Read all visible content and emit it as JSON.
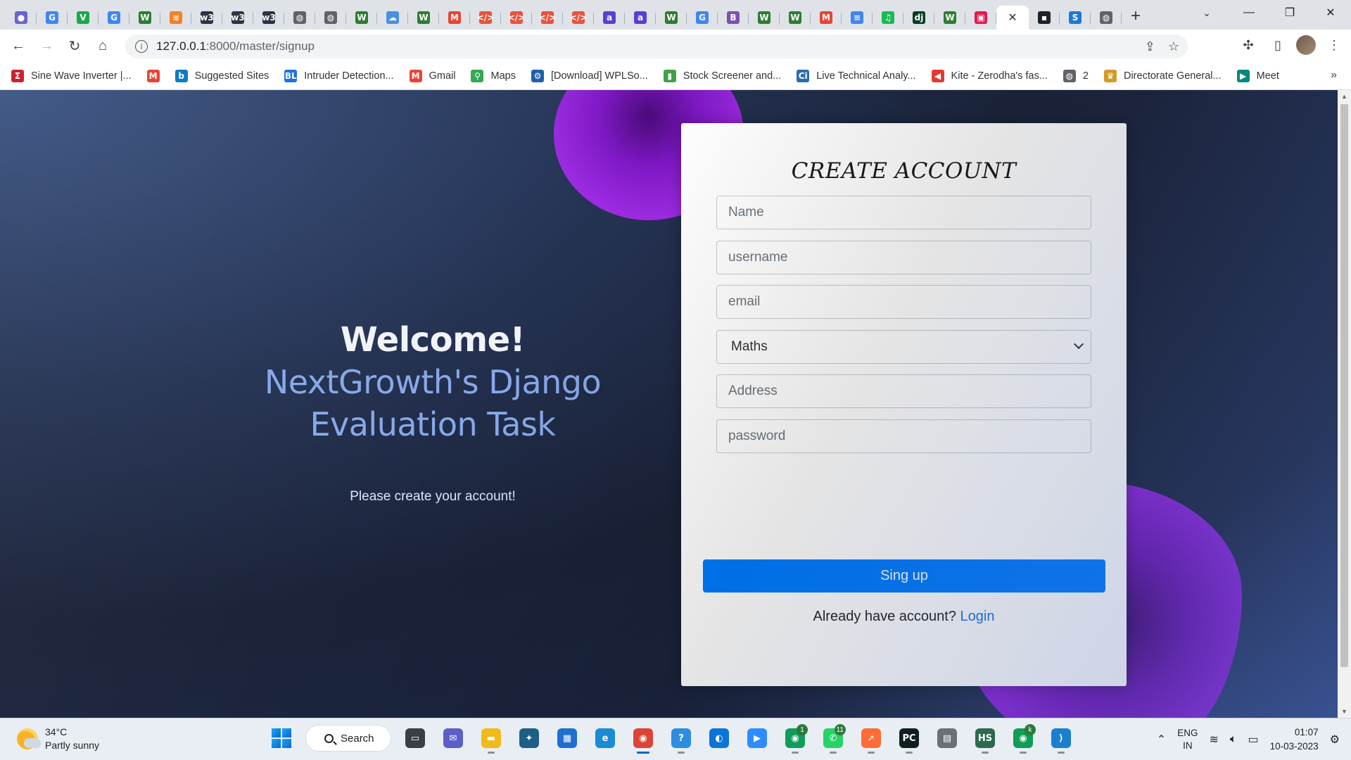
{
  "browser": {
    "tabs": [
      {
        "icon": "copilot-icon",
        "glyph": "●",
        "color": "#6b63d6"
      },
      {
        "icon": "google-icon",
        "glyph": "G",
        "color": "#4285f4"
      },
      {
        "icon": "vuetify-icon",
        "glyph": "V",
        "color": "#1ba84b"
      },
      {
        "icon": "google-icon",
        "glyph": "G",
        "color": "#4285f4"
      },
      {
        "icon": "w-icon",
        "glyph": "W",
        "color": "#2e7d32"
      },
      {
        "icon": "stack-icon",
        "glyph": "≋",
        "color": "#f58025"
      },
      {
        "icon": "w3-icon",
        "glyph": "w3",
        "color": "#2b3443"
      },
      {
        "icon": "w3-icon",
        "glyph": "w3",
        "color": "#2b3443"
      },
      {
        "icon": "w3-icon",
        "glyph": "w3",
        "color": "#2b3443"
      },
      {
        "icon": "globe-icon",
        "glyph": "◍",
        "color": "#5f6368"
      },
      {
        "icon": "globe-icon",
        "glyph": "◍",
        "color": "#5f6368"
      },
      {
        "icon": "w-icon",
        "glyph": "W",
        "color": "#2e7d32"
      },
      {
        "icon": "cloud-icon",
        "glyph": "☁",
        "color": "#4a90e2"
      },
      {
        "icon": "w-icon",
        "glyph": "W",
        "color": "#2e7d32"
      },
      {
        "icon": "gmail-icon",
        "glyph": "M",
        "color": "#ea4335"
      },
      {
        "icon": "code-icon",
        "glyph": "</>",
        "color": "#e8533c"
      },
      {
        "icon": "code-icon",
        "glyph": "</>",
        "color": "#e8533c"
      },
      {
        "icon": "code-icon",
        "glyph": "</>",
        "color": "#e8533c"
      },
      {
        "icon": "code-icon",
        "glyph": "</>",
        "color": "#e8533c"
      },
      {
        "icon": "a-icon",
        "glyph": "a",
        "color": "#5b3fd6"
      },
      {
        "icon": "a-icon",
        "glyph": "a",
        "color": "#5b3fd6"
      },
      {
        "icon": "w-icon",
        "glyph": "W",
        "color": "#2e7d32"
      },
      {
        "icon": "google-icon",
        "glyph": "G",
        "color": "#4285f4"
      },
      {
        "icon": "bootstrap-icon",
        "glyph": "B",
        "color": "#7952b3"
      },
      {
        "icon": "w-icon",
        "glyph": "W",
        "color": "#2e7d32"
      },
      {
        "icon": "w-icon",
        "glyph": "W",
        "color": "#2e7d32"
      },
      {
        "icon": "gmail-icon",
        "glyph": "M",
        "color": "#ea4335"
      },
      {
        "icon": "docs-icon",
        "glyph": "≡",
        "color": "#4285f4"
      },
      {
        "icon": "spotify-icon",
        "glyph": "♫",
        "color": "#1db954"
      },
      {
        "icon": "django-icon",
        "glyph": "dj",
        "color": "#0c3c26"
      },
      {
        "icon": "w-icon",
        "glyph": "W",
        "color": "#2e7d32"
      },
      {
        "icon": "box-icon",
        "glyph": "▣",
        "color": "#e4194f"
      }
    ],
    "trailing_tabs": [
      {
        "icon": "terminal-icon",
        "glyph": "▪",
        "color": "#1f2328"
      },
      {
        "icon": "s-icon",
        "glyph": "S",
        "color": "#1f78d1"
      },
      {
        "icon": "globe-icon",
        "glyph": "◍",
        "color": "#5f6368"
      }
    ],
    "url_host": "127.0.0.1",
    "url_rest": ":8000/master/signup",
    "bookmarks": [
      {
        "label": "Sine Wave Inverter |...",
        "glyph": "Σ",
        "color": "#c9222f"
      },
      {
        "label": "",
        "glyph": "M",
        "color": "#ea4335"
      },
      {
        "label": "Suggested Sites",
        "glyph": "b",
        "color": "#0f7ac6"
      },
      {
        "label": "Intruder Detection...",
        "glyph": "BL",
        "color": "#1a73e8"
      },
      {
        "label": "Gmail",
        "glyph": "M",
        "color": "#ea4335"
      },
      {
        "label": "Maps",
        "glyph": "⚲",
        "color": "#34a853"
      },
      {
        "label": "[Download] WPLSo...",
        "glyph": "⚙",
        "color": "#1f5fa8"
      },
      {
        "label": "Stock Screener and...",
        "glyph": "▮",
        "color": "#43a047"
      },
      {
        "label": "Live Technical Analy...",
        "glyph": "Ci",
        "color": "#2a6db0"
      },
      {
        "label": "Kite - Zerodha's fas...",
        "glyph": "◀",
        "color": "#e53935"
      },
      {
        "label": "2",
        "glyph": "◍",
        "color": "#5f6368"
      },
      {
        "label": "Directorate General...",
        "glyph": "♛",
        "color": "#d39b24"
      },
      {
        "label": "Meet",
        "glyph": "▶",
        "color": "#00897b"
      }
    ],
    "bookmarks_more": "»"
  },
  "page": {
    "welcome": "Welcome!",
    "project_title_line1": "NextGrowth's Django",
    "project_title_line2": "Evaluation Task",
    "subtitle": "Please create your account!",
    "form": {
      "heading": "CREATE ACCOUNT",
      "name_placeholder": "Name",
      "username_placeholder": "username",
      "email_placeholder": "email",
      "subject_selected": "Maths",
      "address_placeholder": "Address",
      "password_placeholder": "password",
      "submit_label": "Sing up",
      "login_prompt": "Already have account?",
      "login_link": "Login"
    }
  },
  "taskbar": {
    "temperature": "34°C",
    "weather": "Partly sunny",
    "search_label": "Search",
    "apps": [
      {
        "icon": "file-explorer-icon",
        "glyph": "▬",
        "color": "#f2b91d",
        "running": true
      },
      {
        "icon": "mysql-workbench-icon",
        "glyph": "✦",
        "color": "#1e5e86",
        "running": false
      },
      {
        "icon": "microsoft-store-icon",
        "glyph": "▦",
        "color": "#1f6fd0",
        "running": false
      },
      {
        "icon": "edge-icon",
        "glyph": "e",
        "color": "#1b8bd3",
        "running": false
      },
      {
        "icon": "chrome-icon",
        "glyph": "◉",
        "color": "#db4437",
        "running": true,
        "active": true
      },
      {
        "icon": "help-icon",
        "glyph": "?",
        "color": "#2d8de0",
        "running": true
      },
      {
        "icon": "screen-icon",
        "glyph": "◐",
        "color": "#0b74d8",
        "running": false
      },
      {
        "icon": "zoom-icon",
        "glyph": "▶",
        "color": "#2d8cff",
        "running": false
      },
      {
        "icon": "chrome-profile-icon",
        "glyph": "◉",
        "color": "#0f9d58",
        "running": true,
        "badge": "1"
      },
      {
        "icon": "whatsapp-icon",
        "glyph": "✆",
        "color": "#25d366",
        "running": true,
        "badge": "11"
      },
      {
        "icon": "postman-icon",
        "glyph": "➚",
        "color": "#ff6c37",
        "running": true
      },
      {
        "icon": "pycharm-icon",
        "glyph": "PC",
        "color": "#0f1f1f",
        "running": true
      },
      {
        "icon": "calculator-icon",
        "glyph": "▤",
        "color": "#6b6f76",
        "running": false
      },
      {
        "icon": "hs-icon",
        "glyph": "HS",
        "color": "#2d6a4f",
        "running": true
      },
      {
        "icon": "chrome-k-icon",
        "glyph": "◉",
        "color": "#0f9d58",
        "running": true,
        "badge": "k"
      },
      {
        "icon": "vscode-icon",
        "glyph": "⟩",
        "color": "#1a7fd0",
        "running": true
      }
    ],
    "lang_top": "ENG",
    "lang_bottom": "IN",
    "time": "01:07",
    "date": "10-03-2023"
  }
}
